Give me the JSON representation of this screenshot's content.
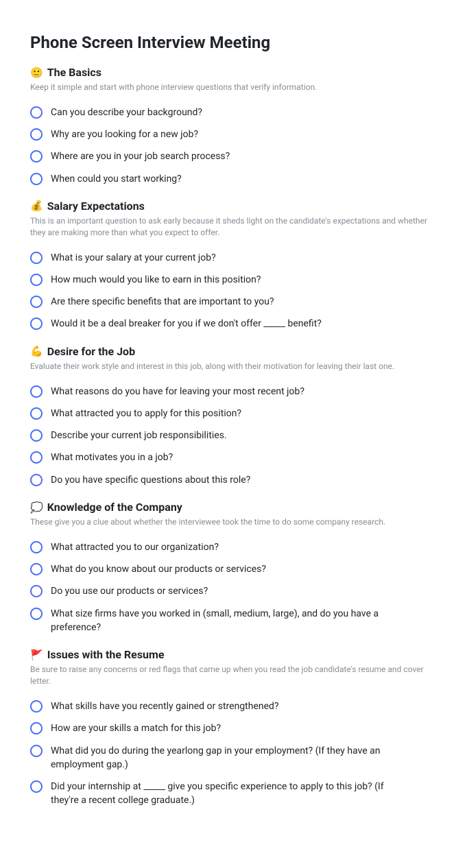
{
  "title": "Phone Screen Interview Meeting",
  "sections": [
    {
      "emoji": "🙂",
      "heading": "The Basics",
      "description": "Keep it simple and start with phone interview questions that verify information.",
      "questions": [
        "Can you describe your background?",
        "Why are you looking for a new job?",
        "Where are you in your job search process?",
        "When could you start working?"
      ]
    },
    {
      "emoji": "💰",
      "heading": "Salary Expectations",
      "description": "This is an important question to ask early because it sheds light on the candidate's expectations and whether they are making more than what you expect to offer.",
      "questions": [
        "What is your salary at your current job?",
        "How much would you like to earn in this position?",
        "Are there specific benefits that are important to you?",
        "Would it be a deal breaker for you if we don't offer _____ benefit?"
      ]
    },
    {
      "emoji": "💪",
      "heading": "Desire for the Job",
      "description": "Evaluate their work style and interest in this job, along with their motivation for leaving their last one.",
      "questions": [
        "What reasons do you have for leaving your most recent job?",
        "What attracted you to apply for this position?",
        "Describe your current job responsibilities.",
        "What motivates you in a job?",
        "Do you have specific questions about this role?"
      ]
    },
    {
      "emoji": "💭",
      "heading": "Knowledge of the Company",
      "description": "These give you a clue about whether the interviewee took the time to do some company research.",
      "questions": [
        "What attracted you to our organization?",
        "What do you know about our products or services?",
        "Do you use our products or services?",
        "What size firms have you worked in (small, medium, large), and do you have a preference?"
      ]
    },
    {
      "emoji": "🚩",
      "heading": "Issues with the Resume",
      "description": "Be sure to raise any concerns or red flags that came up when you read the job candidate's resume and cover letter.",
      "questions": [
        "What skills have you recently gained or strengthened?",
        "How are your skills a match for this job?",
        "What did you do during the yearlong gap in your employment? (If they have an employment gap.)",
        "Did your internship at _____ give you specific experience to apply to this job? (If they're a recent college graduate.)"
      ]
    }
  ]
}
